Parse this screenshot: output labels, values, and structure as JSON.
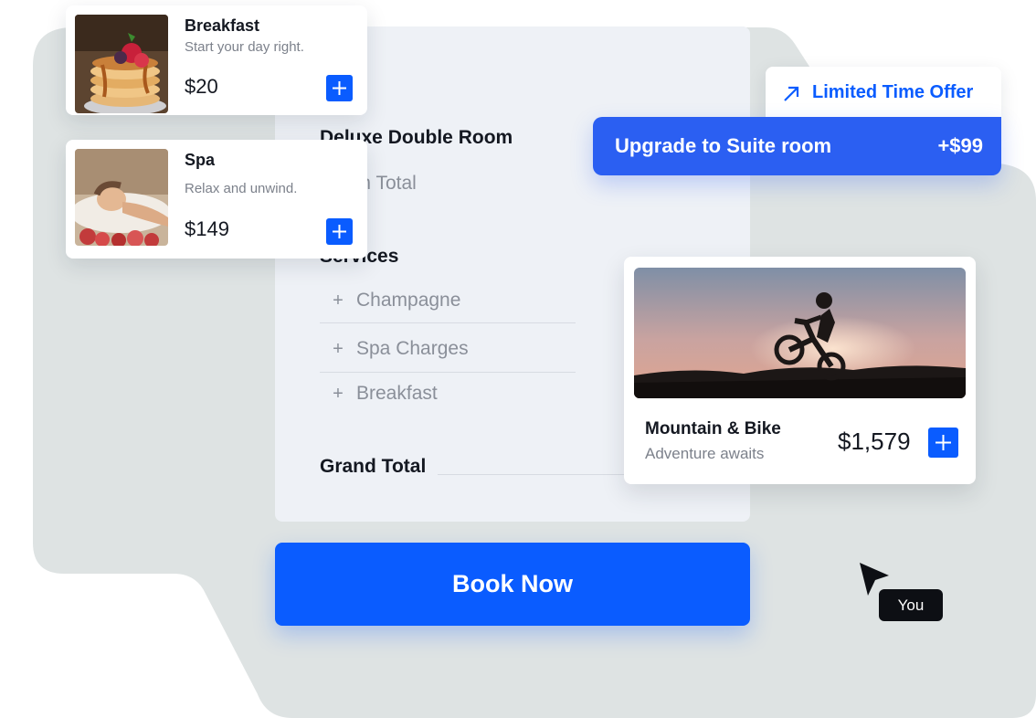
{
  "summary": {
    "room_title": "Deluxe Double Room",
    "room_total": "Room Total",
    "services_title": "Services",
    "services": [
      {
        "label": "Champagne"
      },
      {
        "label": "Spa Charges"
      },
      {
        "label": "Breakfast"
      }
    ],
    "grand_total": "Grand Total"
  },
  "book_button": {
    "label": "Book Now"
  },
  "service_cards": [
    {
      "name": "Breakfast",
      "desc": "Start your day right.",
      "price": "$20"
    },
    {
      "name": "Spa",
      "desc": "Relax and unwind.",
      "price": "$149"
    }
  ],
  "offer": {
    "tab_label": "Limited Time Offer",
    "upgrade_label": "Upgrade to Suite room",
    "upgrade_price": "+$99"
  },
  "package": {
    "name": "Mountain & Bike",
    "desc": "Adventure awaits",
    "price": "$1,579"
  },
  "cursor": {
    "tag": "You"
  },
  "colors": {
    "accent": "#0a5cff",
    "upgrade": "#2b5ff2",
    "background_blob": "#dee3e3",
    "panel": "#eef1f6"
  },
  "icons": [
    "plus-icon",
    "arrow-up-right-icon",
    "cursor-pointer-icon"
  ]
}
